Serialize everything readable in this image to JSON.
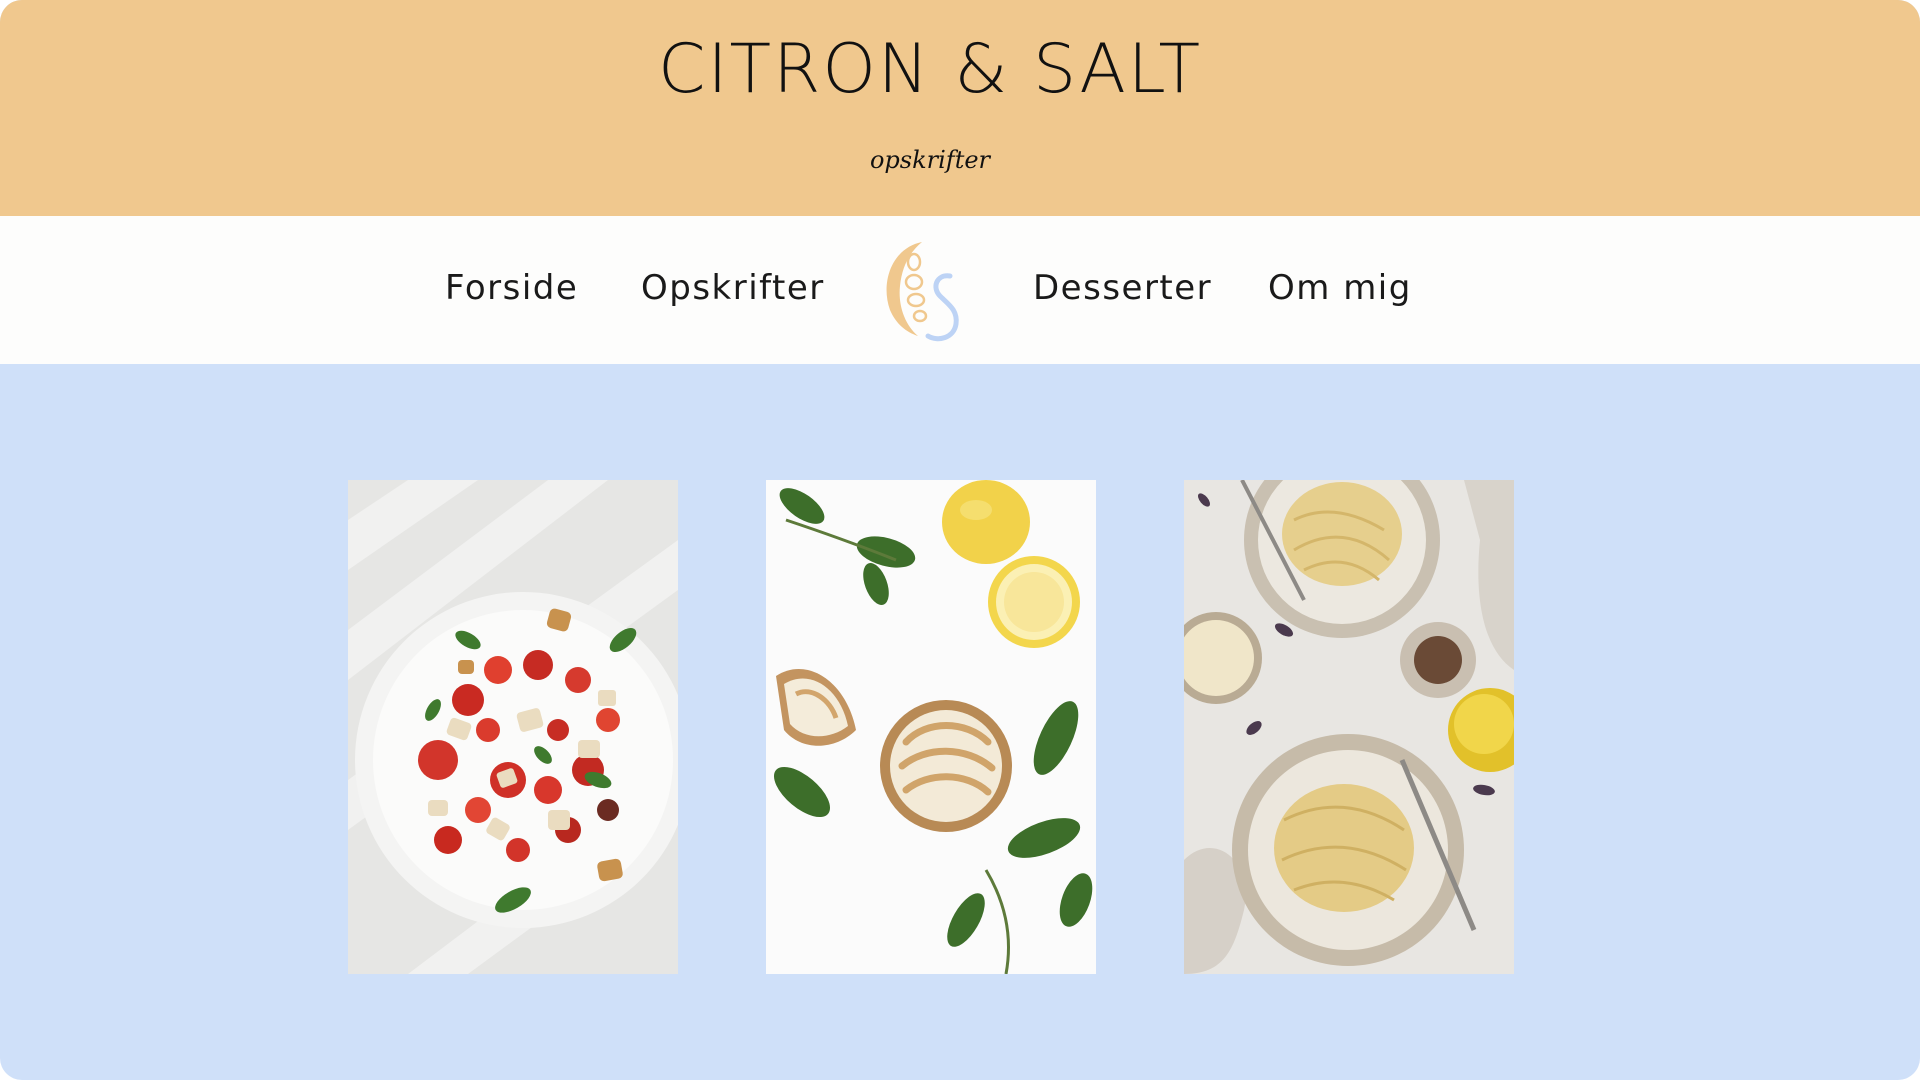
{
  "header": {
    "title": "CITRON & SALT",
    "tagline": "opskrifter"
  },
  "nav": {
    "items": [
      {
        "label": "Forside"
      },
      {
        "label": "Opskrifter"
      },
      {
        "label": "Desserter"
      },
      {
        "label": "Om mig"
      }
    ],
    "logo_icon": "lemon-s-logo-icon"
  },
  "gallery": {
    "cards": [
      {
        "image": "tomato-bread-salad-photo"
      },
      {
        "image": "lemon-meringue-tart-photo"
      },
      {
        "image": "spaghetti-carbonara-photo"
      }
    ]
  },
  "colors": {
    "header_bg": "#f0c88e",
    "nav_bg": "#fdfdfc",
    "page_bg": "#cfe0f9",
    "text": "#111111",
    "logo_lemon": "#f0c88e",
    "logo_s": "#bdd3f5"
  }
}
